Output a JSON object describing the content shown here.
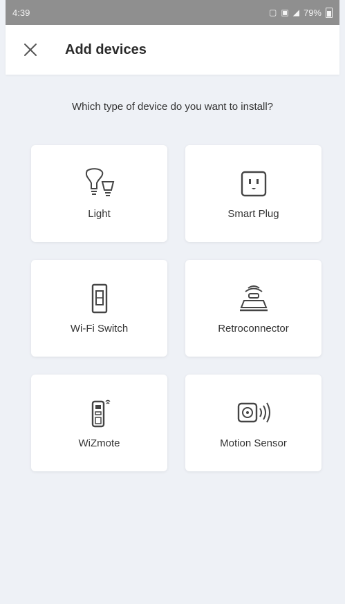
{
  "status_bar": {
    "time": "4:39",
    "battery": "79%"
  },
  "header": {
    "title": "Add devices",
    "close_icon": "close-icon"
  },
  "prompt": "Which type of device do you want to install?",
  "devices": [
    {
      "label": "Light",
      "icon": "light-bulbs-icon"
    },
    {
      "label": "Smart Plug",
      "icon": "smart-plug-icon"
    },
    {
      "label": "Wi-Fi Switch",
      "icon": "wifi-switch-icon"
    },
    {
      "label": "Retroconnector",
      "icon": "retroconnector-icon"
    },
    {
      "label": "WiZmote",
      "icon": "wizmote-icon"
    },
    {
      "label": "Motion Sensor",
      "icon": "motion-sensor-icon"
    }
  ]
}
